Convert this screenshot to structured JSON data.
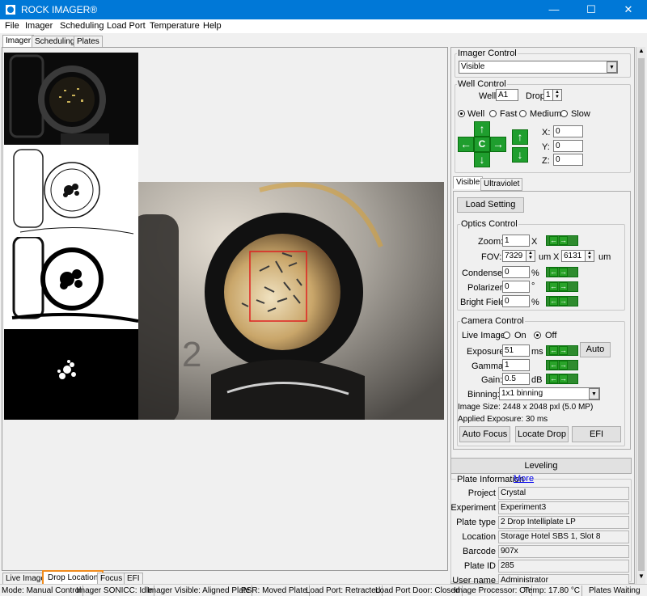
{
  "window": {
    "title": "ROCK IMAGER®",
    "minimize": "—",
    "maximize": "☐",
    "close": "✕"
  },
  "menu": [
    "File",
    "Imager",
    "Scheduling",
    "Load Port",
    "Temperature",
    "Help"
  ],
  "top_tabs": [
    "Imager",
    "Scheduling",
    "Plates"
  ],
  "bottom_tabs": [
    "Live Image",
    "Drop Location",
    "Focus",
    "EFI"
  ],
  "imager_control": {
    "label": "Imager Control",
    "selected": "Visible"
  },
  "well_control": {
    "label": "Well Control",
    "well_label": "Well",
    "well_value": "A1",
    "drop_label": "Drop",
    "drop_value": "1",
    "speed_options": [
      "Well",
      "Fast",
      "Medium",
      "Slow"
    ],
    "speed_selected": "Well",
    "center_label": "C",
    "x_label": "X:",
    "x_value": "0",
    "y_label": "Y:",
    "y_value": "0",
    "z_label": "Z:",
    "z_value": "0"
  },
  "settings_tabs": [
    "Visible",
    "Ultraviolet"
  ],
  "load_setting": "Load Setting",
  "optics": {
    "label": "Optics Control",
    "zoom_label": "Zoom:",
    "zoom_value": "1",
    "zoom_unit": "X",
    "fov_label": "FOV:",
    "fov_w": "7329",
    "fov_unit1": "um",
    "fov_x": "X",
    "fov_h": "6131",
    "fov_unit2": "um",
    "condenser_label": "Condenser:",
    "condenser_value": "0",
    "condenser_unit": "%",
    "polarizer_label": "Polarizer:",
    "polarizer_value": "0",
    "polarizer_unit": "°",
    "bright_label": "Bright Field:",
    "bright_value": "0",
    "bright_unit": "%"
  },
  "camera": {
    "label": "Camera Control",
    "live_label": "Live Image",
    "on_label": "On",
    "off_label": "Off",
    "live_selected": "Off",
    "exposure_label": "Exposure:",
    "exposure_value": "51",
    "exposure_unit": "ms",
    "auto_label": "Auto",
    "gamma_label": "Gamma:",
    "gamma_value": "1",
    "gain_label": "Gain:",
    "gain_value": "0.5",
    "gain_unit": "dB",
    "binning_label": "Binning:",
    "binning_value": "1x1 binning",
    "image_size": "Image Size:  2448 x 2048 pxl (5.0 MP)",
    "applied_exposure": "Applied Exposure: 30 ms",
    "auto_focus": "Auto Focus",
    "locate_drop": "Locate Drop",
    "efi": "EFI"
  },
  "leveling": "Leveling",
  "plate_info": {
    "label": "Plate Information",
    "more": "More",
    "rows": [
      {
        "k": "Project",
        "v": "Crystal"
      },
      {
        "k": "Experiment",
        "v": "Experiment3"
      },
      {
        "k": "Plate type",
        "v": "2 Drop Intelliplate LP"
      },
      {
        "k": "Location",
        "v": "Storage Hotel SBS 1, Slot 8"
      },
      {
        "k": "Barcode",
        "v": "907x"
      },
      {
        "k": "Plate ID",
        "v": "285"
      },
      {
        "k": "User name",
        "v": "Administrator"
      }
    ]
  },
  "status": [
    "Mode: Manual Control",
    "Imager SONICC: Idle",
    "Imager Visible: Aligned Plate",
    "PSR: Moved Plate",
    "Load Port: Retracted",
    "Load Port Door: Closed",
    "Image Processor: On",
    "Temp: 17.80 °C",
    "Plates Waiting"
  ],
  "image_label": "2",
  "colors": {
    "titlebar": "#0078d7",
    "green_button": "#1f9e2e",
    "highlight": "#f08c1e",
    "roi": "#e02020"
  }
}
